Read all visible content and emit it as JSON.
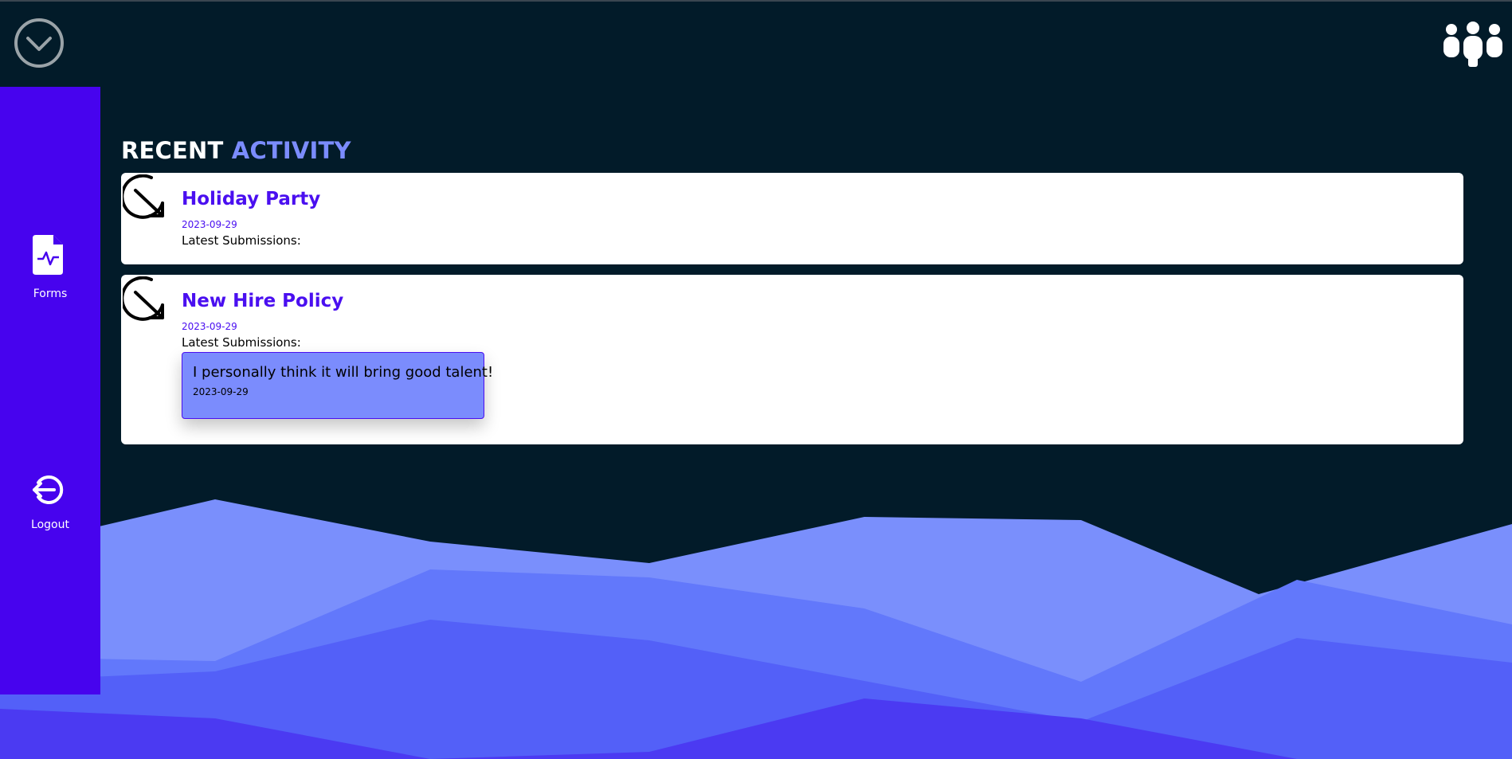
{
  "header": {
    "toggle_icon": "chevron-circle-down-icon",
    "team_icon": "team-icon"
  },
  "sidebar": {
    "items": [
      {
        "label": "Forms",
        "icon": "file-pulse-icon"
      },
      {
        "label": "Logout",
        "icon": "logout-icon"
      }
    ]
  },
  "section": {
    "title_part1": "RECENT",
    "title_part2": "ACTIVITY"
  },
  "activities": [
    {
      "title": "Holiday Party",
      "date": "2023-09-29",
      "submissions_label": "Latest Submissions:",
      "icon": "arrow-down-right-circle-icon",
      "submissions": []
    },
    {
      "title": "New Hire Policy",
      "date": "2023-09-29",
      "submissions_label": "Latest Submissions:",
      "icon": "arrow-down-right-circle-icon",
      "submissions": [
        {
          "text": "I personally think it will bring good talent!",
          "date": "2023-09-29"
        }
      ]
    }
  ],
  "colors": {
    "background": "#021b29",
    "sidebar": "#4703ee",
    "accent": "#7b8cfd",
    "title": "#4a0ff0",
    "wave_1": "#7a8ffc",
    "wave_2": "#6278fb",
    "wave_3": "#5360f8",
    "wave_4": "#4b3af2"
  }
}
